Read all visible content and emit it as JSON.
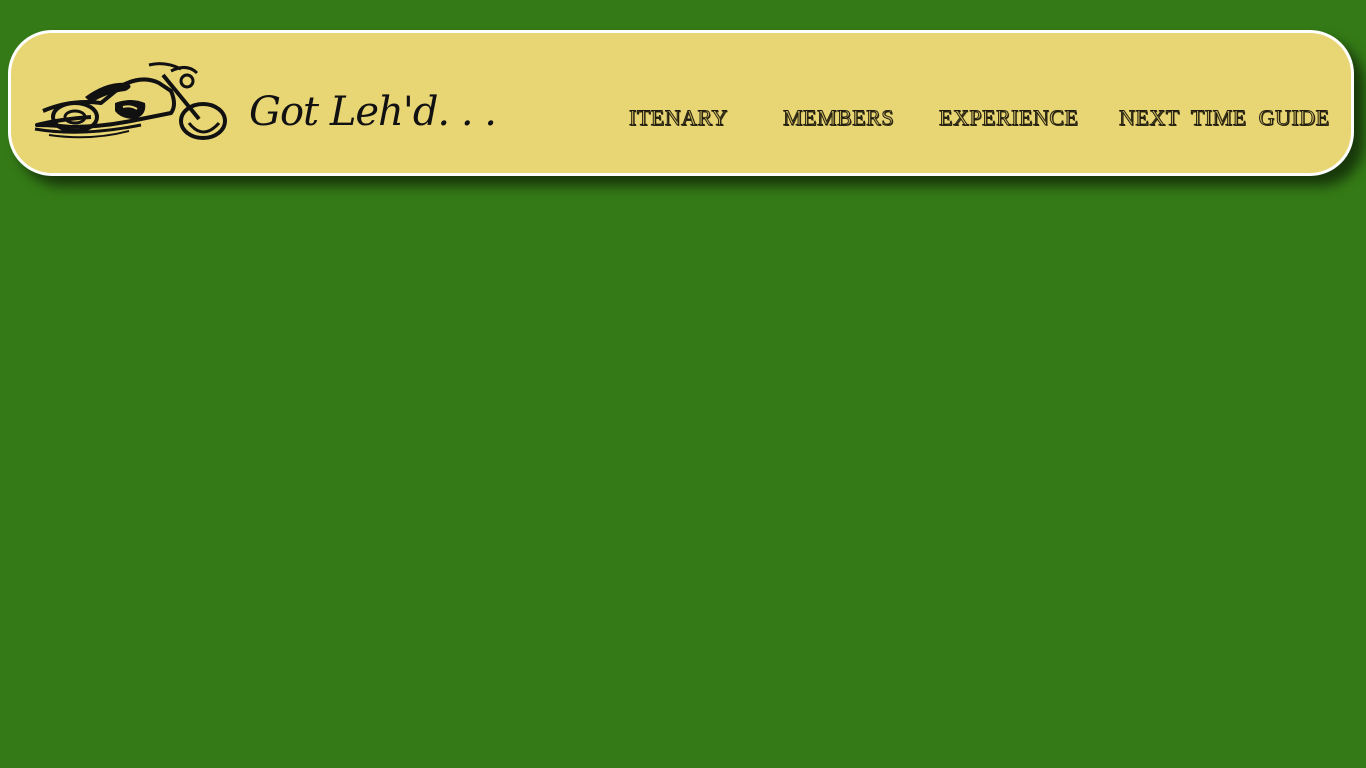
{
  "header": {
    "logo_icon": "motorcycle-icon",
    "title": "Got Leh'd. . ."
  },
  "nav": {
    "items": [
      {
        "label": "ITENARY"
      },
      {
        "label": "MEMBERS"
      },
      {
        "label": "EXPERIENCE"
      },
      {
        "label": "NEXT TIME GUIDE"
      }
    ]
  },
  "colors": {
    "background": "#347a16",
    "header_background": "#e8d574",
    "header_border": "#ffffff",
    "title_text": "#111111"
  }
}
